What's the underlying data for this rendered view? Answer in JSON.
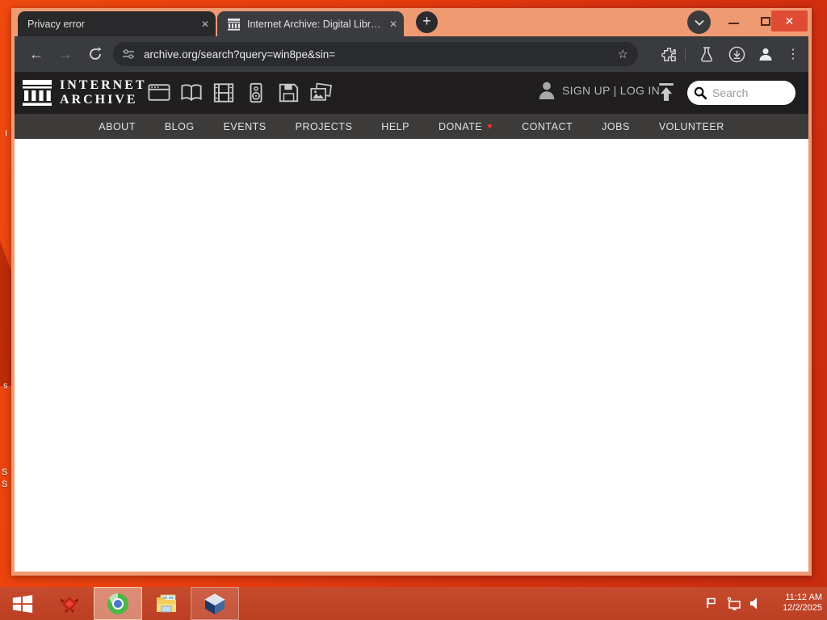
{
  "colors": {
    "desktop_orange": "#e93c0e",
    "titlebar_salmon": "#ef9a73",
    "close_button_red": "#e04b33",
    "chrome_toolbar_dark": "#3a3b3e",
    "ia_header_dark": "#211e1f",
    "ia_nav_gray": "#3c3b3a",
    "taskbar_red": "#c2452a",
    "donate_heart_red": "#ff2a2a"
  },
  "glyphs": {
    "close": "✕",
    "plus": "+",
    "back": "←",
    "forward": "→",
    "star": "☆",
    "dots": "⋮",
    "heart": "♥"
  },
  "browser": {
    "tabs": [
      {
        "title": "Privacy error"
      },
      {
        "title": "Internet Archive: Digital Library"
      }
    ],
    "address": {
      "url": "archive.org/search?query=win8pe&sin="
    }
  },
  "archive_site": {
    "brand_line1": "INTERNET",
    "brand_line2": "ARCHIVE",
    "media_tabs": [
      "web",
      "texts",
      "video",
      "audio",
      "software",
      "images"
    ],
    "account": {
      "label": "SIGN UP | LOG IN"
    },
    "search": {
      "placeholder": "Search"
    },
    "nav": [
      "ABOUT",
      "BLOG",
      "EVENTS",
      "PROJECTS",
      "HELP",
      "DONATE",
      "CONTACT",
      "JOBS",
      "VOLUNTEER"
    ]
  },
  "taskbar": {
    "apps": [
      "start",
      "red-box-app",
      "chrome",
      "file-explorer",
      "virtualbox"
    ],
    "tray": {
      "time": "11:12 AM",
      "date": "12/2/2025"
    }
  },
  "desktop": {
    "icon_label_fragments": [
      "I",
      "s",
      "S",
      "S"
    ]
  }
}
